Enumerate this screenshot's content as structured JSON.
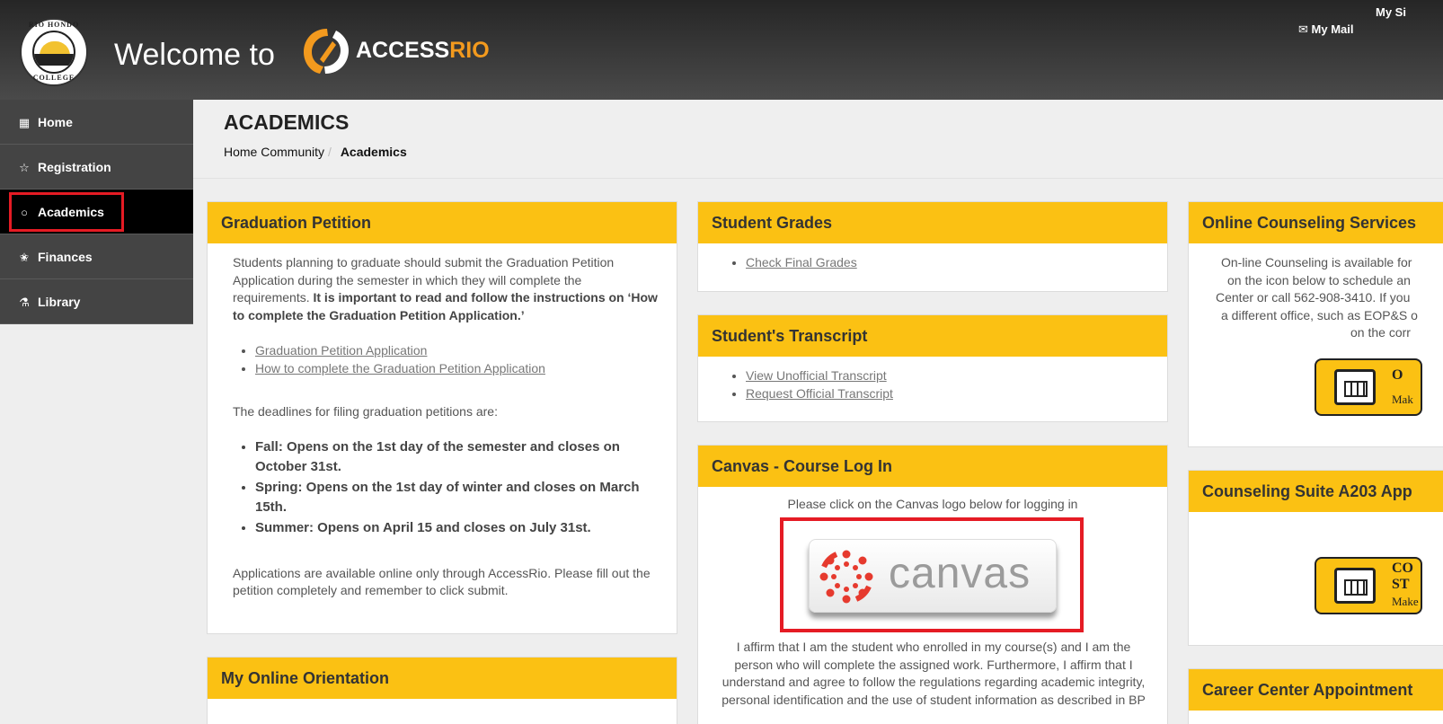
{
  "header": {
    "seal_text_top": "RIO HONDO",
    "seal_text_bottom": "COLLEGE",
    "welcome": "Welcome to",
    "logo_access": "ACCESS",
    "logo_rio": "RIO",
    "my_mail": "My Mail",
    "my_site": "My Si"
  },
  "sidebar": {
    "items": [
      {
        "label": "Home",
        "icon": "grid-icon"
      },
      {
        "label": "Registration",
        "icon": "star-outline-icon"
      },
      {
        "label": "Academics",
        "icon": "circle-icon"
      },
      {
        "label": "Finances",
        "icon": "star-half-icon"
      },
      {
        "label": "Library",
        "icon": "flask-icon"
      }
    ]
  },
  "page": {
    "title": "ACADEMICS",
    "breadcrumb": {
      "home": "Home Community",
      "current": "Academics"
    }
  },
  "graduation": {
    "title": "Graduation Petition",
    "intro": "Students planning to graduate should submit the Graduation Petition Application during the semester in which they will complete the requirements. ",
    "intro_bold": "It is important to read and follow the instructions on ‘How to complete the Graduation Petition Application.’",
    "links": [
      "Graduation Petition Application",
      "How to complete the Graduation Petition Application"
    ],
    "deadlines_intro": "The deadlines for filing graduation petitions are:",
    "deadlines": [
      "Fall: Opens on the 1st day of the semester and closes on October 31st.",
      "Spring: Opens on the 1st day of winter and closes on March 15th.",
      "Summer: Opens on April 15 and closes on July 31st."
    ],
    "outro": "Applications are available online only through AccessRio. Please fill out the petition completely and remember to click submit."
  },
  "orientation": {
    "title": "My Online Orientation"
  },
  "grades": {
    "title": "Student Grades",
    "links": [
      "Check Final Grades"
    ]
  },
  "transcript": {
    "title": "Student's Transcript",
    "links": [
      "View Unofficial Transcript",
      "Request Official Transcript"
    ]
  },
  "canvas": {
    "title": "Canvas - Course Log In",
    "instruction": "Please click on the Canvas logo below for logging in",
    "logo_word": "canvas",
    "affirm": "I affirm that I am the student who enrolled in my course(s) and I am the person who will complete the assigned work. Furthermore, I affirm that I understand and agree to follow the regulations regarding academic integrity, personal identification and the use of student information as described in BP"
  },
  "counseling": {
    "title": "Online Counseling Services",
    "lines": [
      "On-line Counseling is available for",
      "on the icon below to schedule an",
      "Center or call 562-908-3410. If you",
      "a different office, such as EOP&S o",
      "on the corr"
    ],
    "badge_text": "O",
    "badge_sub": "Mak"
  },
  "suite": {
    "title": "Counseling Suite A203 App",
    "badge_text": "CO",
    "badge_text2": "ST",
    "badge_sub": "Make"
  },
  "career": {
    "title": "Career Center Appointment"
  },
  "colors": {
    "accent": "#fbc113",
    "highlight": "#e51b24",
    "nav_bg": "#444444",
    "nav_active": "#000000"
  }
}
